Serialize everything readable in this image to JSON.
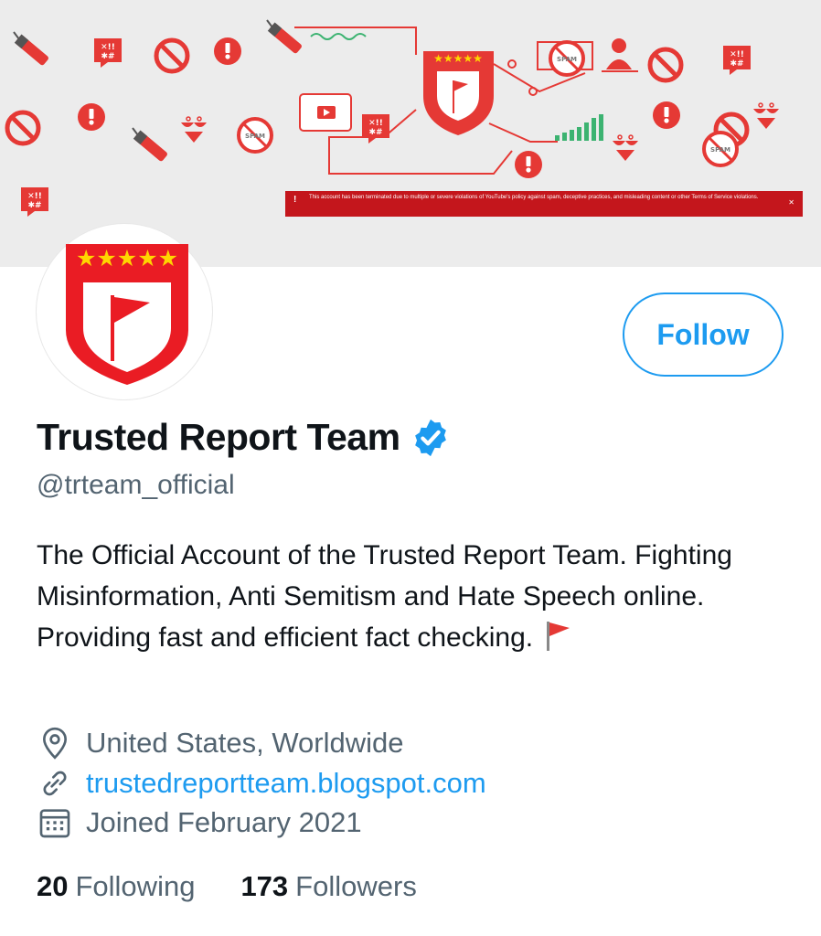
{
  "banner": {
    "termination_notice": "This account has been terminated due to multiple or severe violations of YouTube's policy against spam, deceptive practices, and misleading content or other Terms of Service violations.",
    "spam_label": "SPAM",
    "colors": {
      "background": "#ececec",
      "red": "#e53935",
      "dark_red": "#c4161c",
      "gold": "#ffd600",
      "green": "#3cb371"
    }
  },
  "profile": {
    "display_name": "Trusted Report Team",
    "handle": "@trteam_official",
    "verified": true,
    "follow_label": "Follow",
    "bio": "The Official Account of the Trusted Report Team. Fighting Misinformation, Anti Semitism and Hate Speech online. Providing fast and efficient fact checking.",
    "location": "United States, Worldwide",
    "url": "trustedreportteam.blogspot.com",
    "joined": "Joined February 2021",
    "stats": {
      "following_count": "20",
      "following_label": "Following",
      "followers_count": "173",
      "followers_label": "Followers"
    }
  },
  "icons": [
    "location-pin-icon",
    "link-icon",
    "calendar-icon",
    "verified-badge-icon",
    "red-flag-icon",
    "shield-flag-logo-icon"
  ],
  "colors": {
    "accent": "#1d9bf0",
    "text": "#0f1419",
    "secondary_text": "#536471"
  }
}
